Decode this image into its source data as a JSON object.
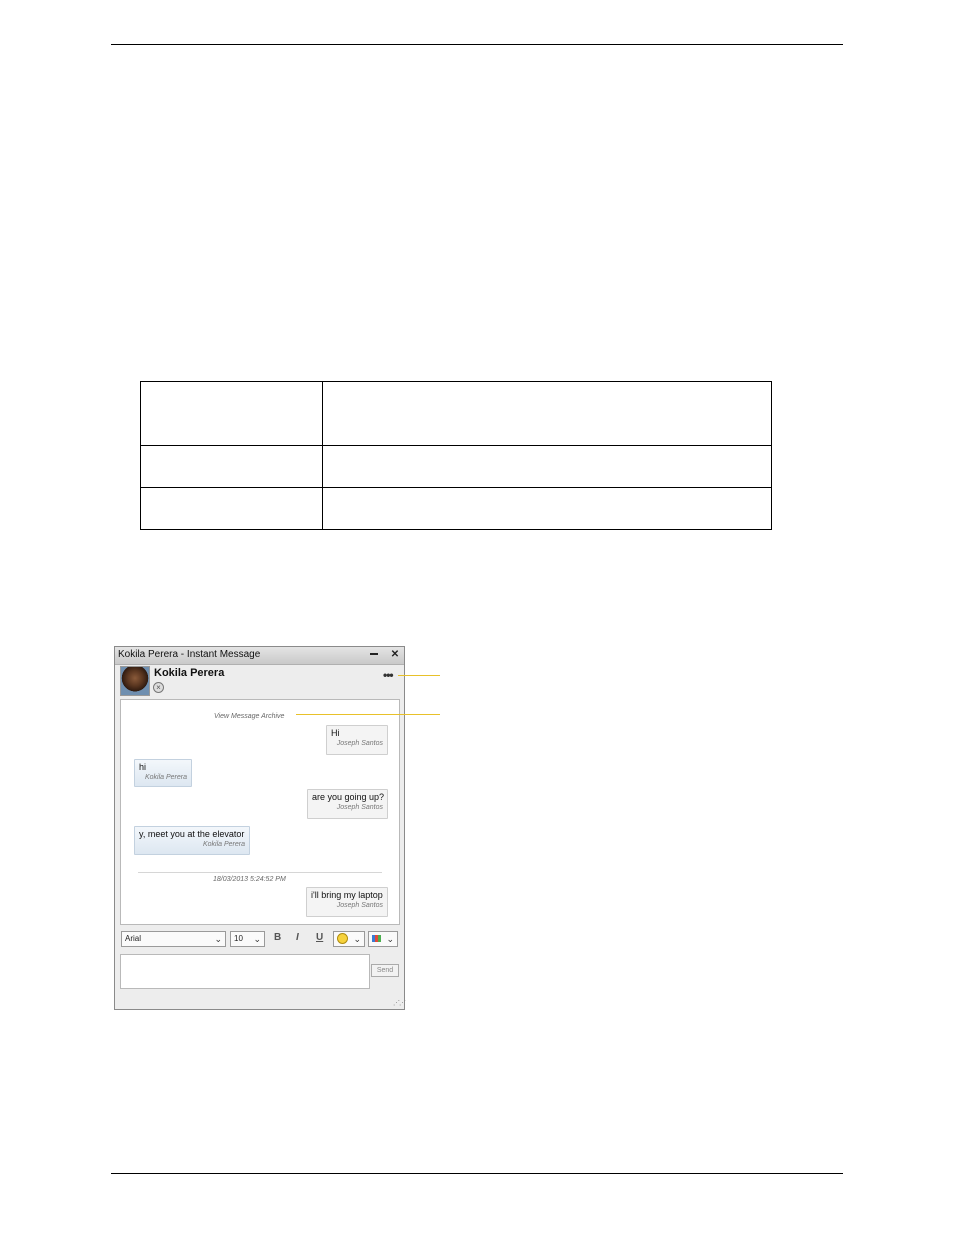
{
  "window": {
    "title": "Kokila Perera - Instant Message",
    "contact_name": "Kokila Perera"
  },
  "chat": {
    "archive_link": "View Message Archive",
    "timestamp": "18/03/2013 5:24:52 PM",
    "messages": [
      {
        "text": "Hi",
        "sender": "Joseph Santos"
      },
      {
        "text": "hi",
        "sender": "Kokila Perera"
      },
      {
        "text": "are you going up?",
        "sender": "Joseph Santos"
      },
      {
        "text": "y, meet you at the elevator",
        "sender": "Kokila Perera"
      },
      {
        "text": "i'll bring my laptop",
        "sender": "Joseph Santos"
      }
    ]
  },
  "toolbar": {
    "font": "Arial",
    "size": "10",
    "bold": "B",
    "italic": "I",
    "underline": "U"
  },
  "composer": {
    "send_label": "Send"
  },
  "icons": {
    "status": "busy-status-icon",
    "more": "more-options-icon",
    "emoji": "emoticon-icon",
    "color": "color-palette-icon"
  },
  "colors": {
    "callout": "#e8c12a"
  }
}
